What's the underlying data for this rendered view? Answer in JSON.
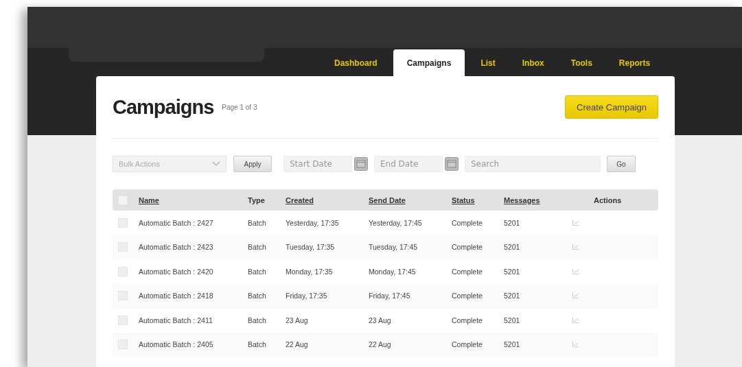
{
  "nav": {
    "tabs": [
      {
        "label": "Dashboard",
        "selected": false
      },
      {
        "label": "Campaigns",
        "selected": true
      },
      {
        "label": "List",
        "selected": false
      },
      {
        "label": "Inbox",
        "selected": false
      },
      {
        "label": "Tools",
        "selected": false
      },
      {
        "label": "Reports",
        "selected": false
      }
    ]
  },
  "page": {
    "title": "Campaigns",
    "pagination": "Page 1 of 3",
    "create_button": "Create Campaign"
  },
  "filters": {
    "bulk_actions": "Bulk Actions",
    "apply_button": "Apply",
    "start_date": {
      "placeholder": "Start Date"
    },
    "end_date": {
      "placeholder": "End Date"
    },
    "search": {
      "placeholder": "Search"
    },
    "go_button": "Go"
  },
  "table": {
    "select_all_checked": false,
    "columns": [
      {
        "label": "Name",
        "sortable": true
      },
      {
        "label": "Type",
        "sortable": false
      },
      {
        "label": "Created",
        "sortable": true
      },
      {
        "label": "Send Date",
        "sortable": true
      },
      {
        "label": "Status",
        "sortable": true
      },
      {
        "label": "Messages",
        "sortable": true
      },
      {
        "label": "Actions",
        "sortable": false
      }
    ],
    "rows": [
      {
        "checked": false,
        "name": "Automatic Batch : 2427",
        "type": "Batch",
        "created": "Yesterday, 17:35",
        "send_date": "Yesterday, 17:45",
        "status": "Complete",
        "messages": "5201"
      },
      {
        "checked": false,
        "name": "Automatic Batch : 2423",
        "type": "Batch",
        "created": "Tuesday, 17:35",
        "send_date": "Tuesday, 17:45",
        "status": "Complete",
        "messages": "5201"
      },
      {
        "checked": false,
        "name": "Automatic Batch : 2420",
        "type": "Batch",
        "created": "Monday, 17:35",
        "send_date": "Monday, 17:45",
        "status": "Complete",
        "messages": "5201"
      },
      {
        "checked": false,
        "name": "Automatic Batch : 2418",
        "type": "Batch",
        "created": "Friday, 17:35",
        "send_date": "Friday, 17:45",
        "status": "Complete",
        "messages": "5201"
      },
      {
        "checked": false,
        "name": "Automatic Batch : 2411",
        "type": "Batch",
        "created": "23 Aug",
        "send_date": "23 Aug",
        "status": "Complete",
        "messages": "5201"
      },
      {
        "checked": false,
        "name": "Automatic Batch : 2405",
        "type": "Batch",
        "created": "22 Aug",
        "send_date": "22 Aug",
        "status": "Complete",
        "messages": "5201"
      }
    ]
  }
}
